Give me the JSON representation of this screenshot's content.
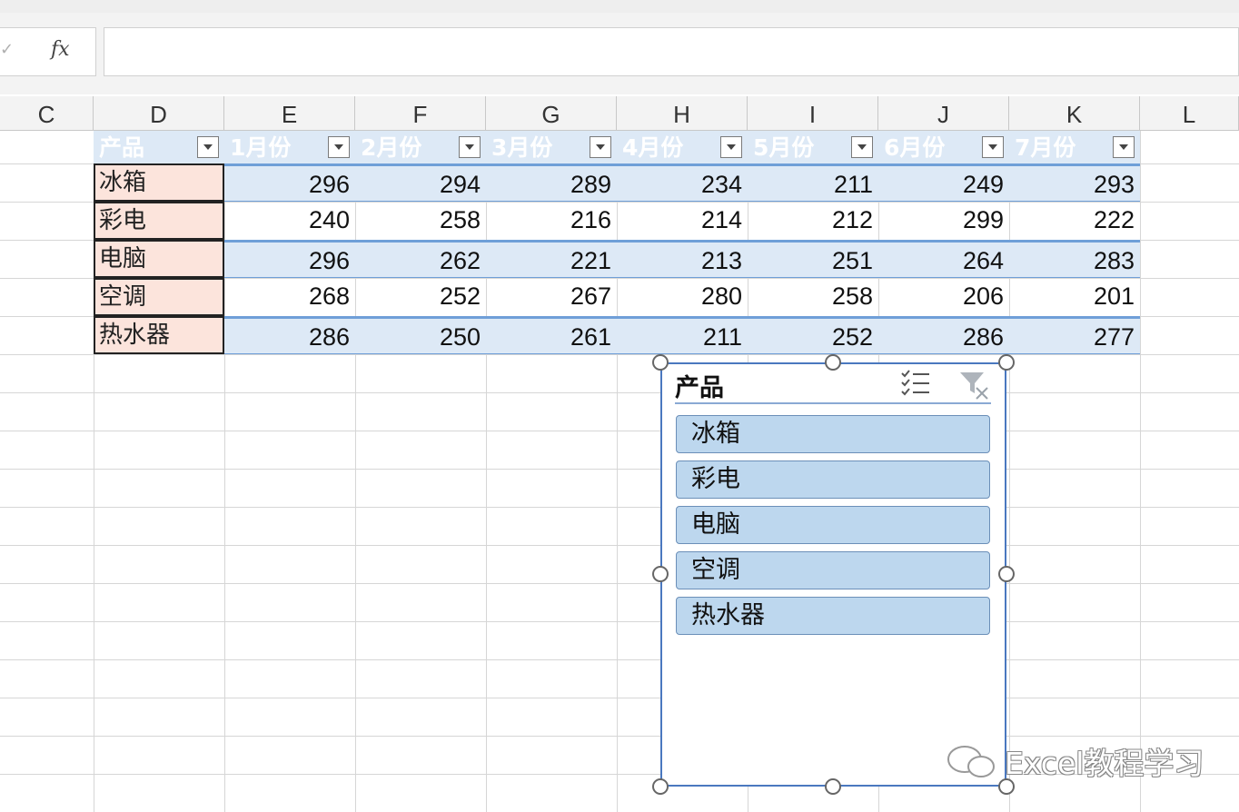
{
  "formula_bar": {
    "fx_label": "fx",
    "value": ""
  },
  "columns": [
    "C",
    "D",
    "E",
    "F",
    "G",
    "H",
    "I",
    "J",
    "K",
    "L"
  ],
  "table": {
    "headers": [
      "产品",
      "1月份",
      "2月份",
      "3月份",
      "4月份",
      "5月份",
      "6月份",
      "7月份"
    ],
    "rows": [
      {
        "product": "冰箱",
        "values": [
          "296",
          "294",
          "289",
          "234",
          "211",
          "249",
          "293"
        ]
      },
      {
        "product": "彩电",
        "values": [
          "240",
          "258",
          "216",
          "214",
          "212",
          "299",
          "222"
        ]
      },
      {
        "product": "电脑",
        "values": [
          "296",
          "262",
          "221",
          "213",
          "251",
          "264",
          "283"
        ]
      },
      {
        "product": "空调",
        "values": [
          "268",
          "252",
          "267",
          "280",
          "258",
          "206",
          "201"
        ]
      },
      {
        "product": "热水器",
        "values": [
          "286",
          "250",
          "261",
          "211",
          "252",
          "286",
          "277"
        ]
      }
    ]
  },
  "slicer": {
    "title": "产品",
    "items": [
      "冰箱",
      "彩电",
      "电脑",
      "空调",
      "热水器"
    ],
    "multi_select_icon": "multi-select-icon",
    "clear_filter_icon": "clear-filter-icon"
  },
  "watermark": {
    "text": "Excel教程学习"
  },
  "colors": {
    "header_fill": "#dde9f6",
    "band_fill": "#dde9f6",
    "product_fill": "#fce4dc",
    "slicer_item_fill": "#bdd7ee",
    "slicer_border": "#4a78bf"
  }
}
